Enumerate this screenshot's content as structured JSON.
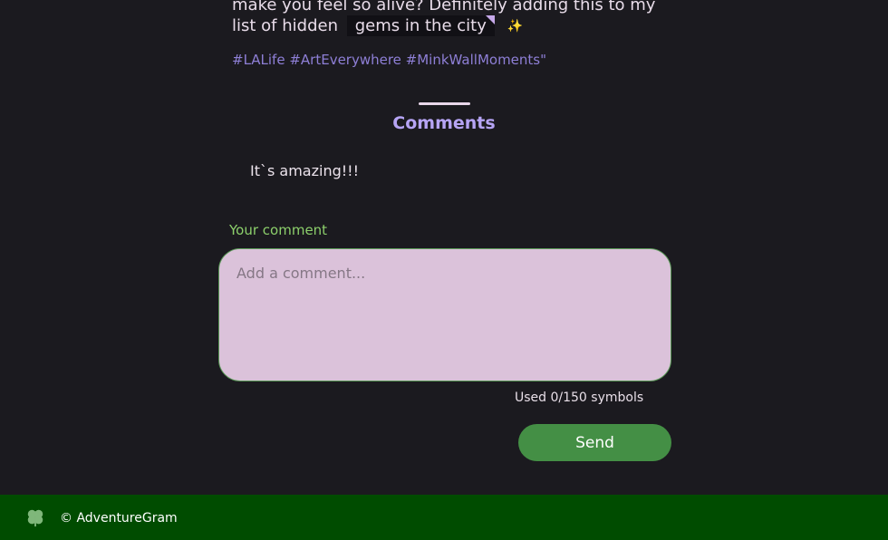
{
  "post": {
    "line1": "make you feel so alive? Definitely adding this to my",
    "line2_prefix": "list of hidden",
    "highlight": "gems in the city",
    "sparkle": "✨",
    "hashtags": "#LALife #ArtEverywhere #MinkWallMoments\""
  },
  "comments": {
    "title": "Comments",
    "items": [
      {
        "text": "It`s amazing!!!"
      }
    ]
  },
  "form": {
    "label": "Your comment",
    "placeholder": "Add a comment...",
    "value": "",
    "counter": "Used 0/150 symbols",
    "send_label": "Send"
  },
  "footer": {
    "text": "© AdventureGram",
    "icon": "clover-icon"
  },
  "colors": {
    "background": "#1b1a1f",
    "accent": "#b6a4f4",
    "hashtag": "#8e7fd6",
    "label": "#8ccf6b",
    "send_button": "#448f45",
    "comment_box": "#dbc2da",
    "footer": "#004c00"
  }
}
